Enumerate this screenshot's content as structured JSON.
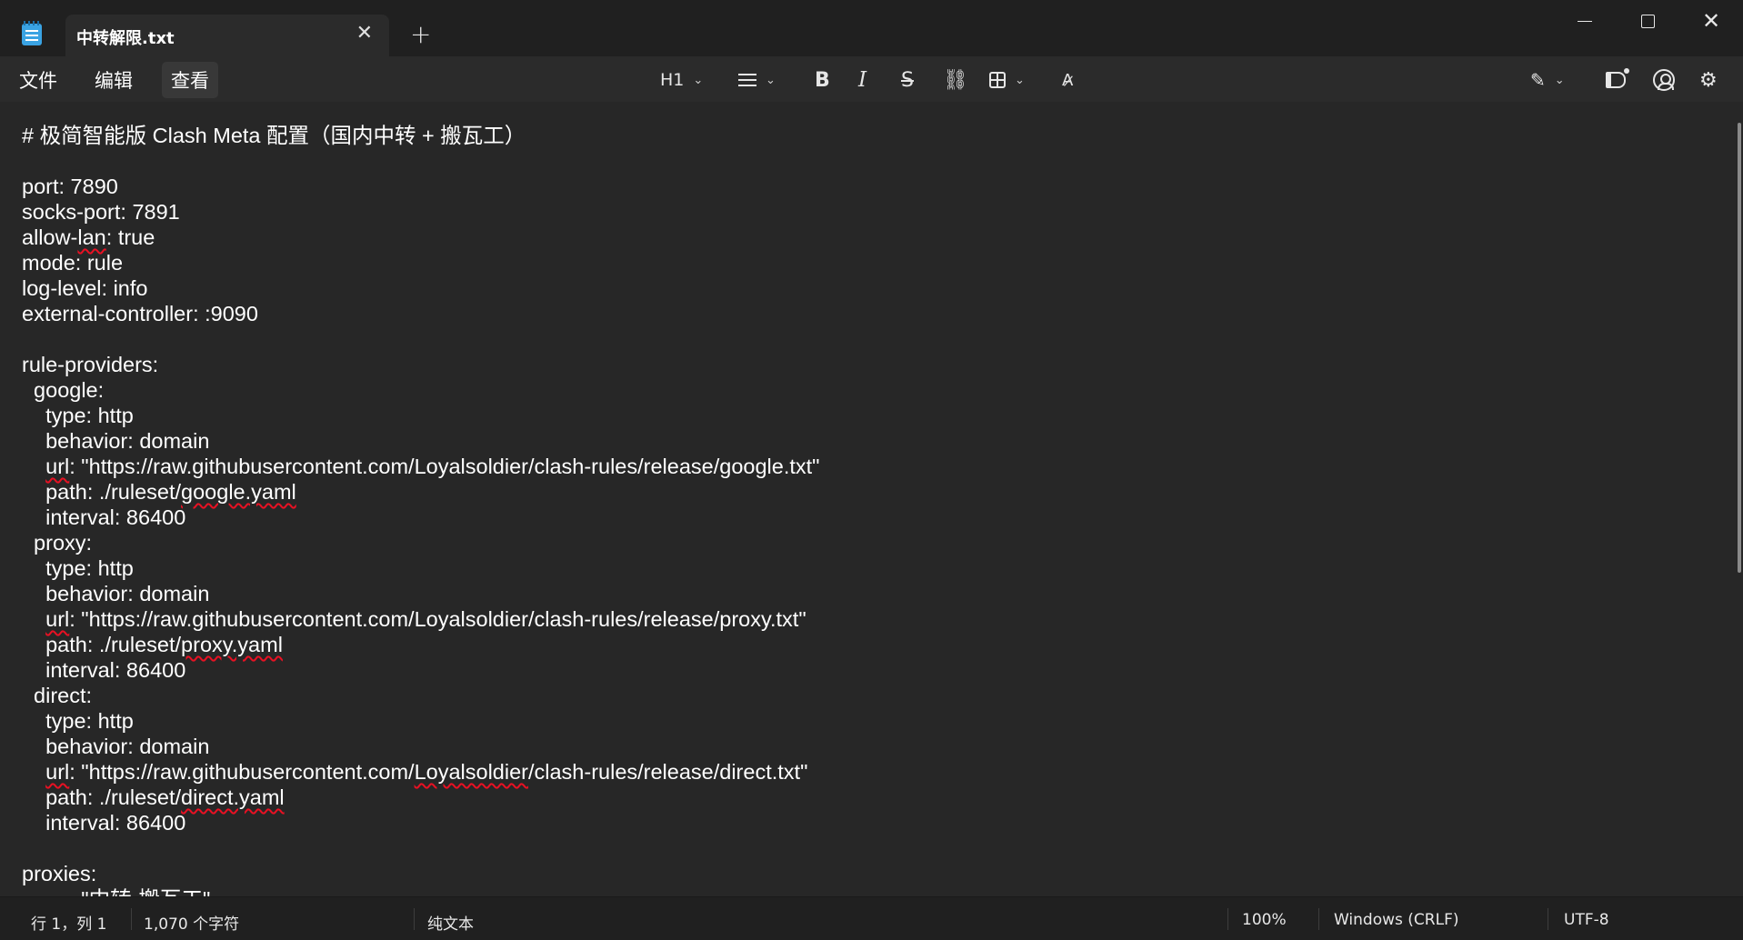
{
  "window": {
    "tab_title": "中转解限.txt",
    "tab_close": "✕",
    "new_tab": "+",
    "close_glyph": "✕"
  },
  "menu": {
    "file": "文件",
    "edit": "编辑",
    "view": "查看"
  },
  "toolbar": {
    "heading": "H1",
    "bold": "B",
    "italic": "I",
    "strike": "S",
    "link": "⛓",
    "spell": "A̷",
    "ai": "✎",
    "settings": "⚙",
    "chevron": "⌄"
  },
  "editor": {
    "lines": [
      "# 极简智能版 Clash Meta 配置（国内中转 + 搬瓦工）",
      "",
      "port: 7890",
      "socks-port: 7891",
      "allow-lan: true",
      "mode: rule",
      "log-level: info",
      "external-controller: :9090",
      "",
      "rule-providers:",
      "  google:",
      "    type: http",
      "    behavior: domain",
      "    url: \"https://raw.githubusercontent.com/Loyalsoldier/clash-rules/release/google.txt\"",
      "    path: ./ruleset/google.yaml",
      "    interval: 86400",
      "  proxy:",
      "    type: http",
      "    behavior: domain",
      "    url: \"https://raw.githubusercontent.com/Loyalsoldier/clash-rules/release/proxy.txt\"",
      "    path: ./ruleset/proxy.yaml",
      "    interval: 86400",
      "  direct:",
      "    type: http",
      "    behavior: domain",
      "    url: \"https://raw.githubusercontent.com/Loyalsoldier/clash-rules/release/direct.txt\"",
      "    path: ./ruleset/direct.yaml",
      "    interval: 86400",
      "",
      "proxies:",
      "          \"中转-搬瓦工\""
    ],
    "squiggles": [
      "lan",
      "url",
      "google.yaml",
      "proxy.yaml",
      "Loyalsoldier",
      "direct.yaml"
    ]
  },
  "status": {
    "position": "行 1，列 1",
    "char_count": "1,070 个字符",
    "format": "纯文本",
    "zoom": "100%",
    "line_ending": "Windows (CRLF)",
    "encoding": "UTF-8"
  }
}
